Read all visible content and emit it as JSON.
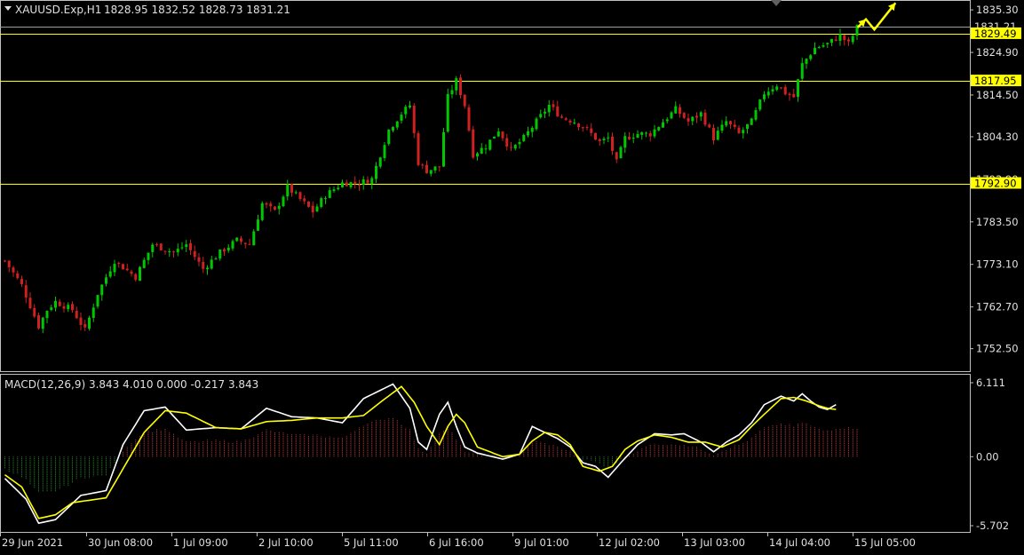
{
  "header": {
    "symbol": "XAUUSD.Exp,H1",
    "ohlc": "1828.95 1832.52 1828.73 1831.21"
  },
  "macd_header": "MACD(12,26,9) 3.843 4.010 0.000 -0.217 3.843",
  "colors": {
    "background": "#000000",
    "bull": "#00c800",
    "bear": "#d02020",
    "level_line": "#ffff00",
    "axis": "#c0c0c0",
    "macd_main": "#ffffff",
    "macd_signal": "#ffff00",
    "hist_pos": "#c84040",
    "hist_neg": "#2e8b2e"
  },
  "chart_data": [
    {
      "type": "candlestick",
      "title": "XAUUSD.Exp,H1",
      "ylim": [
        1747.0,
        1837.5
      ],
      "y_ticks": [
        1835.3,
        1824.9,
        1814.5,
        1804.3,
        1793.9,
        1783.5,
        1773.1,
        1762.7,
        1752.5
      ],
      "price_labels": [
        {
          "value": 1831.21,
          "label": "1831.21"
        },
        {
          "value": 1829.49,
          "label": "1829.49"
        },
        {
          "value": 1817.95,
          "label": "1817.95"
        },
        {
          "value": 1792.9,
          "label": "1792.90"
        }
      ],
      "horizontal_levels": [
        1829.49,
        1817.95,
        1792.9
      ],
      "x_labels": [
        "29 Jun 2021",
        "30 Jun 08:00",
        "1 Jul 09:00",
        "2 Jul 10:00",
        "5 Jul 11:00",
        "6 Jul 16:00",
        "9 Jul 01:00",
        "12 Jul 02:00",
        "13 Jul 03:00",
        "14 Jul 04:00",
        "15 Jul 05:00"
      ],
      "close_path": [
        [
          0,
          1774
        ],
        [
          4,
          1768
        ],
        [
          8,
          1758
        ],
        [
          10,
          1762
        ],
        [
          12,
          1764
        ],
        [
          16,
          1762
        ],
        [
          19,
          1757
        ],
        [
          22,
          1766
        ],
        [
          26,
          1774
        ],
        [
          31,
          1770
        ],
        [
          35,
          1778
        ],
        [
          40,
          1776
        ],
        [
          43,
          1778
        ],
        [
          47,
          1772
        ],
        [
          51,
          1776
        ],
        [
          55,
          1779
        ],
        [
          58,
          1778
        ],
        [
          61,
          1788
        ],
        [
          64,
          1786
        ],
        [
          67,
          1792
        ],
        [
          70,
          1789
        ],
        [
          73,
          1786
        ],
        [
          76,
          1790
        ],
        [
          80,
          1793
        ],
        [
          84,
          1793
        ],
        [
          87,
          1794
        ],
        [
          91,
          1806
        ],
        [
          94,
          1810
        ],
        [
          96,
          1812
        ],
        [
          98,
          1798
        ],
        [
          100,
          1796
        ],
        [
          103,
          1797
        ],
        [
          105,
          1814
        ],
        [
          107,
          1818
        ],
        [
          109,
          1812
        ],
        [
          111,
          1800
        ],
        [
          114,
          1802
        ],
        [
          117,
          1806
        ],
        [
          120,
          1801
        ],
        [
          123,
          1804
        ],
        [
          126,
          1808
        ],
        [
          129,
          1812
        ],
        [
          132,
          1809
        ],
        [
          135,
          1808
        ],
        [
          138,
          1806
        ],
        [
          141,
          1803
        ],
        [
          143,
          1804
        ],
        [
          145,
          1798
        ],
        [
          147,
          1804
        ],
        [
          150,
          1805
        ],
        [
          153,
          1805
        ],
        [
          156,
          1808
        ],
        [
          159,
          1811
        ],
        [
          162,
          1808
        ],
        [
          165,
          1810
        ],
        [
          168,
          1804
        ],
        [
          171,
          1808
        ],
        [
          174,
          1805
        ],
        [
          177,
          1808
        ],
        [
          180,
          1815
        ],
        [
          183,
          1817
        ],
        [
          185,
          1815
        ],
        [
          187,
          1814
        ],
        [
          189,
          1822
        ],
        [
          192,
          1826
        ],
        [
          195,
          1827
        ],
        [
          198,
          1829
        ],
        [
          200,
          1827
        ],
        [
          202,
          1831
        ]
      ],
      "arrow_path": [
        [
          202,
          1831
        ],
        [
          204,
          1833
        ],
        [
          206,
          1830.5
        ],
        [
          211,
          1837
        ]
      ],
      "n_bars": 203
    },
    {
      "type": "line",
      "title": "MACD(12,26,9)",
      "ylim": [
        -5.702,
        6.111
      ],
      "y_ticks": [
        6.111,
        0.0,
        -5.702
      ],
      "series": [
        {
          "name": "MACD",
          "values": [
            [
              0,
              -1.8
            ],
            [
              5,
              -3.5
            ],
            [
              8,
              -5.5
            ],
            [
              12,
              -5.2
            ],
            [
              18,
              -3.2
            ],
            [
              24,
              -2.8
            ],
            [
              28,
              1.0
            ],
            [
              33,
              3.8
            ],
            [
              38,
              4.1
            ],
            [
              43,
              2.2
            ],
            [
              50,
              2.4
            ],
            [
              56,
              2.3
            ],
            [
              62,
              4.0
            ],
            [
              68,
              3.3
            ],
            [
              74,
              3.2
            ],
            [
              80,
              2.8
            ],
            [
              85,
              4.8
            ],
            [
              92,
              6.0
            ],
            [
              96,
              4.0
            ],
            [
              98,
              1.2
            ],
            [
              100,
              0.6
            ],
            [
              103,
              3.5
            ],
            [
              105,
              4.5
            ],
            [
              107,
              2.5
            ],
            [
              109,
              0.8
            ],
            [
              112,
              0.3
            ],
            [
              118,
              -0.2
            ],
            [
              122,
              0.2
            ],
            [
              125,
              2.5
            ],
            [
              128,
              2.0
            ],
            [
              131,
              1.5
            ],
            [
              134,
              0.8
            ],
            [
              137,
              -0.5
            ],
            [
              140,
              -0.8
            ],
            [
              143,
              -1.7
            ],
            [
              146,
              -0.5
            ],
            [
              150,
              1.0
            ],
            [
              154,
              1.9
            ],
            [
              158,
              1.8
            ],
            [
              161,
              1.9
            ],
            [
              165,
              1.2
            ],
            [
              168,
              0.4
            ],
            [
              171,
              1.2
            ],
            [
              174,
              1.8
            ],
            [
              177,
              2.8
            ],
            [
              180,
              4.3
            ],
            [
              184,
              5.0
            ],
            [
              187,
              4.6
            ],
            [
              189,
              5.2
            ],
            [
              191,
              4.6
            ],
            [
              193,
              4.1
            ],
            [
              195,
              3.9
            ],
            [
              197,
              4.3
            ]
          ]
        },
        {
          "name": "Signal",
          "values": [
            [
              0,
              -1.5
            ],
            [
              4,
              -2.5
            ],
            [
              8,
              -5.1
            ],
            [
              12,
              -4.8
            ],
            [
              16,
              -3.8
            ],
            [
              24,
              -3.4
            ],
            [
              28,
              -1.0
            ],
            [
              33,
              2.0
            ],
            [
              38,
              3.8
            ],
            [
              43,
              3.6
            ],
            [
              50,
              2.4
            ],
            [
              56,
              2.3
            ],
            [
              62,
              2.9
            ],
            [
              68,
              3.0
            ],
            [
              74,
              3.2
            ],
            [
              80,
              3.2
            ],
            [
              85,
              3.4
            ],
            [
              89,
              4.5
            ],
            [
              94,
              5.8
            ],
            [
              97,
              4.5
            ],
            [
              100,
              2.5
            ],
            [
              103,
              1.0
            ],
            [
              105,
              2.5
            ],
            [
              107,
              3.5
            ],
            [
              109,
              2.8
            ],
            [
              112,
              0.8
            ],
            [
              118,
              0.0
            ],
            [
              122,
              0.2
            ],
            [
              125,
              1.3
            ],
            [
              128,
              2.0
            ],
            [
              131,
              1.8
            ],
            [
              134,
              1.0
            ],
            [
              137,
              -0.8
            ],
            [
              141,
              -1.2
            ],
            [
              144,
              -0.8
            ],
            [
              147,
              0.6
            ],
            [
              150,
              1.3
            ],
            [
              154,
              1.8
            ],
            [
              158,
              1.6
            ],
            [
              162,
              1.2
            ],
            [
              166,
              1.2
            ],
            [
              170,
              0.8
            ],
            [
              174,
              1.4
            ],
            [
              177,
              2.5
            ],
            [
              180,
              3.5
            ],
            [
              184,
              4.8
            ],
            [
              187,
              4.9
            ],
            [
              190,
              4.6
            ],
            [
              193,
              4.2
            ],
            [
              195,
              4.0
            ],
            [
              197,
              3.9
            ]
          ]
        }
      ]
    }
  ]
}
